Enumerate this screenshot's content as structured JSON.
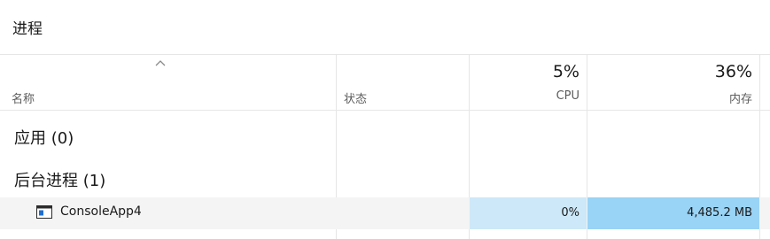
{
  "page_title": "进程",
  "columns": {
    "name": {
      "label": "名称"
    },
    "status": {
      "label": "状态"
    },
    "cpu": {
      "label": "CPU",
      "percent": "5%"
    },
    "memory": {
      "label": "内存",
      "percent": "36%"
    }
  },
  "groups": [
    {
      "title": "应用 (0)"
    },
    {
      "title": "后台进程 (1)"
    }
  ],
  "processes": [
    {
      "name": "ConsoleApp4",
      "status": "",
      "cpu": "0%",
      "memory": "4,485.2 MB",
      "icon": "console-window-icon"
    }
  ],
  "colors": {
    "cpu_highlight": "#cde8f8",
    "memory_highlight": "#99d3f5",
    "row_highlight": "#f4f4f4"
  }
}
